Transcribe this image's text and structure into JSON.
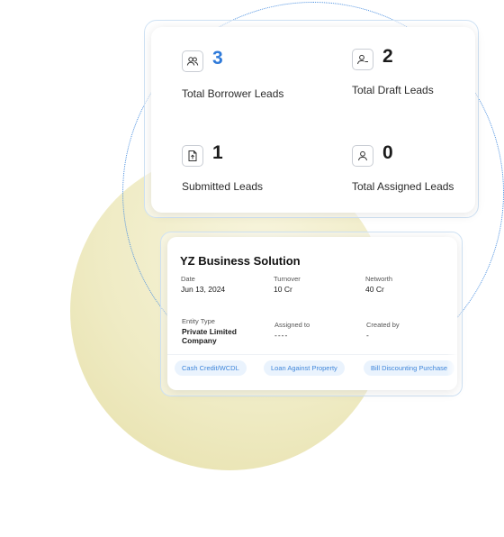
{
  "stats": {
    "borrower_leads": {
      "count": "3",
      "label": "Total Borrower Leads",
      "icon": "users-icon",
      "count_color": "#2f7ad9"
    },
    "draft_leads": {
      "count": "2",
      "label": "Total Draft Leads",
      "icon": "user-minus-icon"
    },
    "submitted_leads": {
      "count": "1",
      "label": "Submitted Leads",
      "icon": "file-upload-icon"
    },
    "assigned_leads": {
      "count": "0",
      "label": "Total Assigned Leads",
      "icon": "user-icon"
    }
  },
  "business": {
    "title": "YZ Business Solution",
    "date_label": "Date",
    "date_value": "Jun 13, 2024",
    "turnover_label": "Turnover",
    "turnover_value": "10 Cr",
    "networth_label": "Networth",
    "networth_value": "40 Cr",
    "entity_label": "Entity Type",
    "entity_value": "Private Limited Company",
    "assigned_label": "Assigned to",
    "assigned_value": "----",
    "created_label": "Created by",
    "created_value": "-",
    "tags": [
      "Cash Credit/WCDL",
      "Loan Against Property",
      "Bill Discounting Purchase"
    ]
  },
  "colors": {
    "accent": "#2f7ad9",
    "chip_bg": "#eaf3fd",
    "chip_text": "#3f86da",
    "circle": "#efebc4"
  }
}
